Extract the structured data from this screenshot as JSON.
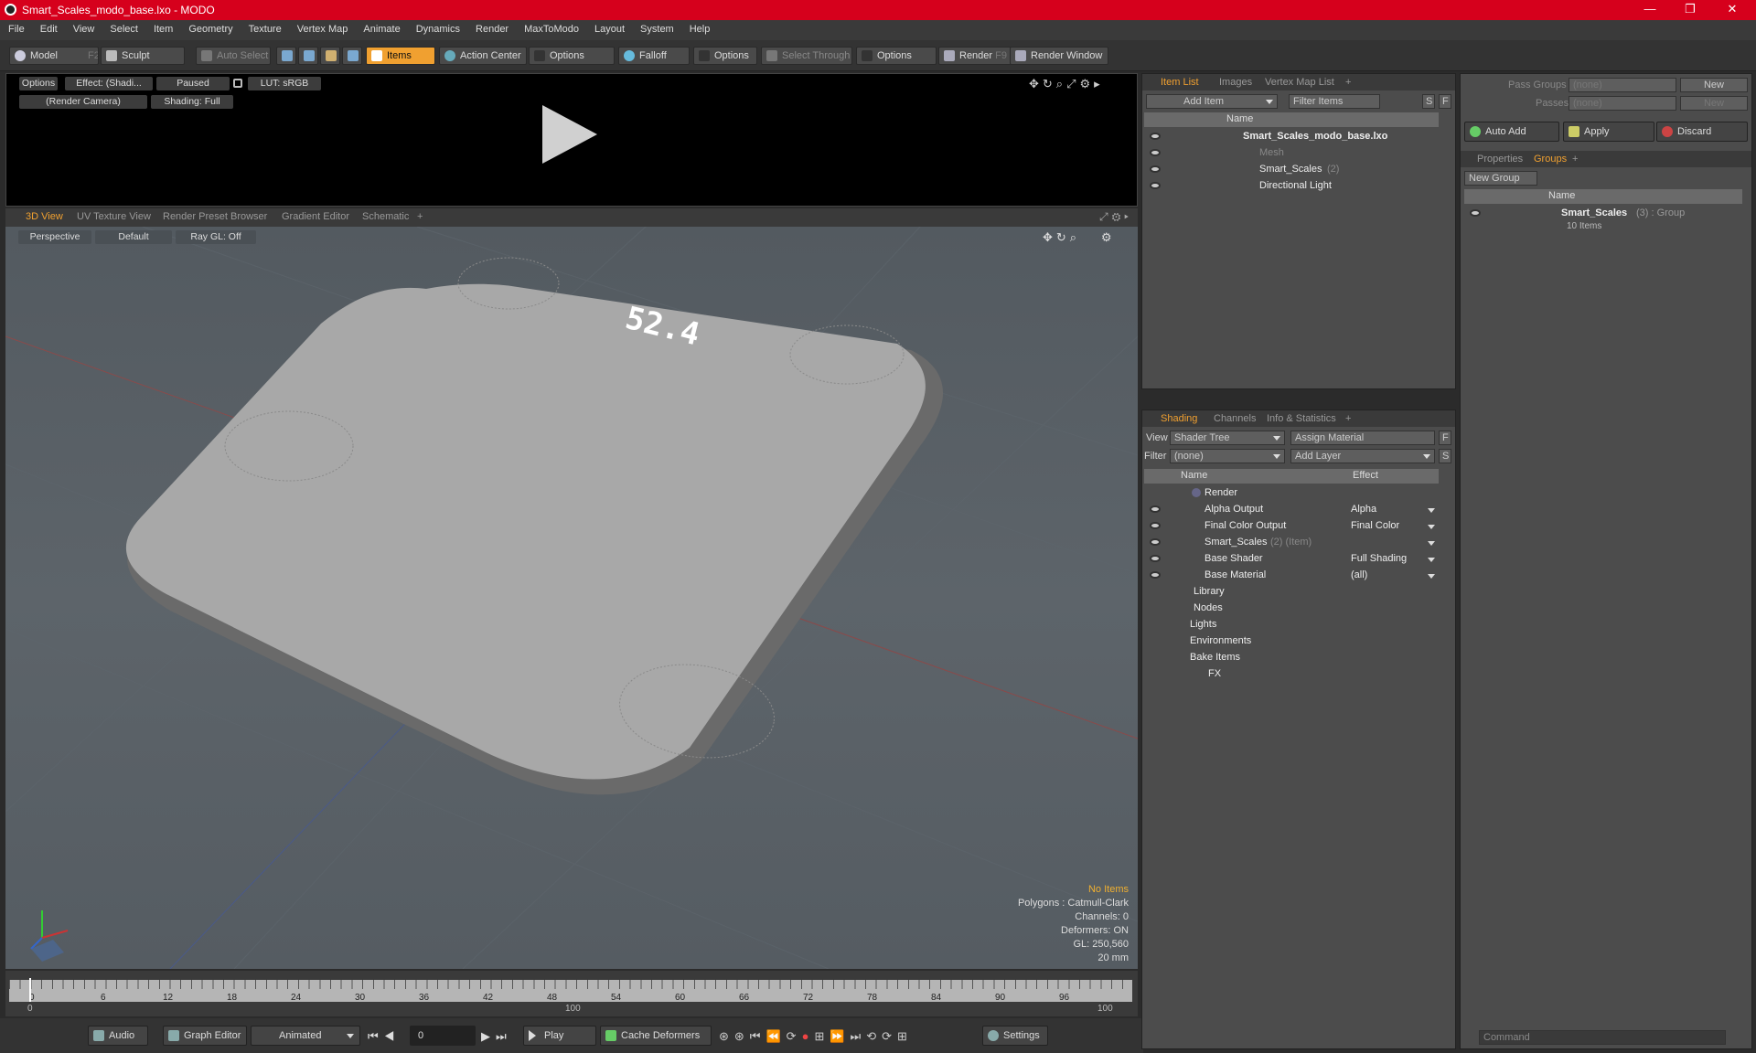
{
  "window": {
    "title": "Smart_Scales_modo_base.lxo - MODO",
    "minimize": "—",
    "maximize": "❐",
    "close": "✕"
  },
  "menu": [
    "File",
    "Edit",
    "View",
    "Select",
    "Item",
    "Geometry",
    "Texture",
    "Vertex Map",
    "Animate",
    "Dynamics",
    "Render",
    "MaxToModo",
    "Layout",
    "System",
    "Help"
  ],
  "toolbar": {
    "model": "Model",
    "model_key": "F2",
    "sculpt": "Sculpt",
    "auto_select": "Auto Select",
    "items": "Items",
    "action_center": "Action Center",
    "options1": "Options",
    "falloff": "Falloff",
    "options2": "Options",
    "select_through": "Select Through",
    "options3": "Options",
    "render": "Render",
    "render_key": "F9",
    "render_window": "Render Window"
  },
  "preview": {
    "options": "Options",
    "effect": "Effect: (Shadi...",
    "paused": "Paused",
    "lut": "LUT: sRGB",
    "camera": "(Render Camera)",
    "shading": "Shading: Full"
  },
  "viewport_tabs": [
    "3D View",
    "UV Texture View",
    "Render Preset Browser",
    "Gradient Editor",
    "Schematic",
    "+"
  ],
  "viewport": {
    "perspective": "Perspective",
    "default": "Default",
    "raygl": "Ray GL: Off",
    "display_text": "52.4",
    "stats": {
      "no_items": "No Items",
      "polygons": "Polygons : Catmull-Clark",
      "channels": "Channels: 0",
      "deformers": "Deformers: ON",
      "gl": "GL: 250,560",
      "scale": "20 mm"
    }
  },
  "timeline": {
    "ticks": [
      "0",
      "6",
      "12",
      "18",
      "24",
      "30",
      "36",
      "42",
      "48",
      "54",
      "60",
      "66",
      "72",
      "78",
      "84",
      "90",
      "96"
    ],
    "lower": [
      "0",
      "100",
      "100"
    ]
  },
  "bottom": {
    "audio": "Audio",
    "graph_editor": "Graph Editor",
    "animated": "Animated",
    "frame": "0",
    "play": "Play",
    "cache": "Cache Deformers",
    "settings": "Settings"
  },
  "item_list": {
    "tabs": [
      "Item List",
      "Images",
      "Vertex Map List",
      "+"
    ],
    "add_item": "Add Item",
    "filter": "Filter Items",
    "s": "S",
    "f": "F",
    "col_name": "Name",
    "rows": [
      {
        "label": "Smart_Scales_modo_base.lxo",
        "extra": ""
      },
      {
        "label": "Mesh",
        "extra": ""
      },
      {
        "label": "Smart_Scales",
        "extra": "(2)"
      },
      {
        "label": "Directional Light",
        "extra": ""
      }
    ]
  },
  "shading": {
    "tabs": [
      "Shading",
      "Channels",
      "Info & Statistics",
      "+"
    ],
    "view_label": "View",
    "view_value": "Shader Tree",
    "assign": "Assign Material",
    "f": "F",
    "filter_label": "Filter",
    "filter_value": "(none)",
    "add_layer": "Add Layer",
    "s": "S",
    "col_name": "Name",
    "col_effect": "Effect",
    "rows": [
      {
        "name": "Render",
        "effect": ""
      },
      {
        "name": "Alpha Output",
        "effect": "Alpha"
      },
      {
        "name": "Final Color Output",
        "effect": "Final Color"
      },
      {
        "name": "Smart_Scales",
        "extra": "(2) (Item)",
        "effect": ""
      },
      {
        "name": "Base Shader",
        "effect": "Full Shading"
      },
      {
        "name": "Base Material",
        "effect": "(all)"
      },
      {
        "name": "Library",
        "effect": ""
      },
      {
        "name": "Nodes",
        "effect": ""
      },
      {
        "name": "Lights",
        "effect": ""
      },
      {
        "name": "Environments",
        "effect": ""
      },
      {
        "name": "Bake Items",
        "effect": ""
      },
      {
        "name": "FX",
        "effect": ""
      }
    ]
  },
  "groups_panel": {
    "pass_groups": "Pass Groups",
    "passes": "Passes",
    "none": "(none)",
    "new": "New",
    "auto_add": "Auto Add",
    "apply": "Apply",
    "discard": "Discard",
    "tabs": [
      "Properties",
      "Groups",
      "+"
    ],
    "new_group": "New Group",
    "col_name": "Name",
    "group_name": "Smart_Scales",
    "group_extra": "(3) : Group",
    "group_items": "10 Items",
    "command": "Command"
  }
}
